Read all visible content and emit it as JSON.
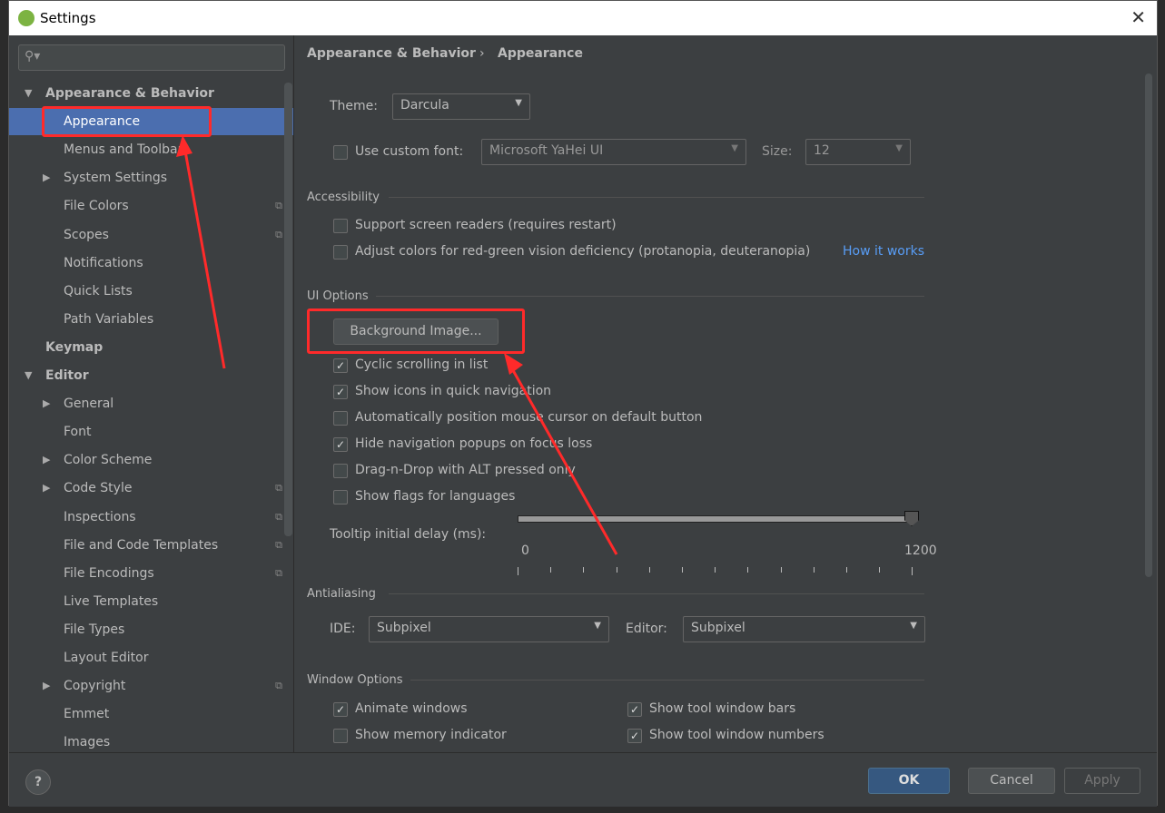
{
  "window": {
    "title": "Settings",
    "close": "✕"
  },
  "search": {
    "placeholder": "",
    "icon": "search-icon"
  },
  "sidebar": {
    "items": [
      {
        "label": "Appearance & Behavior",
        "bold": true,
        "expanded": true
      },
      {
        "label": "Appearance",
        "selected": true
      },
      {
        "label": "Menus and Toolbars"
      },
      {
        "label": "System Settings",
        "expandable": true
      },
      {
        "label": "File Colors",
        "copy": true
      },
      {
        "label": "Scopes",
        "copy": true
      },
      {
        "label": "Notifications"
      },
      {
        "label": "Quick Lists"
      },
      {
        "label": "Path Variables"
      },
      {
        "label": "Keymap",
        "bold": true
      },
      {
        "label": "Editor",
        "bold": true,
        "expanded": true
      },
      {
        "label": "General",
        "expandable": true
      },
      {
        "label": "Font"
      },
      {
        "label": "Color Scheme",
        "expandable": true
      },
      {
        "label": "Code Style",
        "expandable": true,
        "copy": true
      },
      {
        "label": "Inspections",
        "copy": true
      },
      {
        "label": "File and Code Templates",
        "copy": true
      },
      {
        "label": "File Encodings",
        "copy": true
      },
      {
        "label": "Live Templates"
      },
      {
        "label": "File Types"
      },
      {
        "label": "Layout Editor"
      },
      {
        "label": "Copyright",
        "expandable": true,
        "copy": true
      },
      {
        "label": "Emmet"
      },
      {
        "label": "Images"
      }
    ]
  },
  "breadcrumb": {
    "parent": "Appearance & Behavior",
    "sep": "›",
    "current": "Appearance"
  },
  "theme": {
    "label": "Theme:",
    "value": "Darcula"
  },
  "font": {
    "checkbox": "Use custom font:",
    "checked": false,
    "value": "Microsoft YaHei UI",
    "size_label": "Size:",
    "size": "12"
  },
  "accessibility": {
    "title": "Accessibility",
    "screen_readers": "Support screen readers (requires restart)",
    "color_adjust": "Adjust colors for red-green vision deficiency (protanopia, deuteranopia)",
    "how_link": "How it works"
  },
  "ui_options": {
    "title": "UI Options",
    "bg_button": "Background Image...",
    "options": [
      {
        "label": "Cyclic scrolling in list",
        "checked": true
      },
      {
        "label": "Show icons in quick navigation",
        "checked": true
      },
      {
        "label": "Automatically position mouse cursor on default button",
        "checked": false
      },
      {
        "label": "Hide navigation popups on focus loss",
        "checked": true
      },
      {
        "label": "Drag-n-Drop with ALT pressed only",
        "checked": false
      },
      {
        "label": "Show flags for languages",
        "checked": false
      }
    ],
    "tooltip_label": "Tooltip initial delay (ms):",
    "tooltip_min": "0",
    "tooltip_max": "1200",
    "tooltip_value": 1200
  },
  "antialiasing": {
    "title": "Antialiasing",
    "ide_label": "IDE:",
    "ide": "Subpixel",
    "editor_label": "Editor:",
    "editor": "Subpixel"
  },
  "window_options": {
    "title": "Window Options",
    "animate": "Animate windows",
    "memory": "Show memory indicator",
    "bars": "Show tool window bars",
    "numbers": "Show tool window numbers"
  },
  "footer": {
    "help": "?",
    "ok": "OK",
    "cancel": "Cancel",
    "apply": "Apply"
  },
  "colors": {
    "accent": "#4b6eaf",
    "ok": "#365880",
    "link": "#589df6",
    "annotation": "#ff2a2a"
  }
}
